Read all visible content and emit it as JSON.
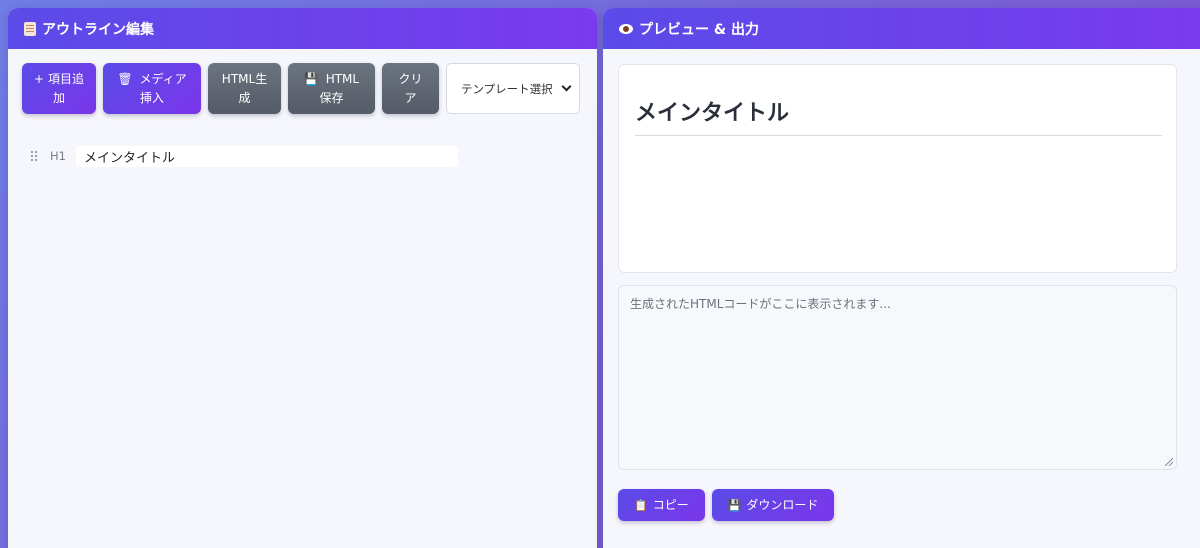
{
  "left_panel": {
    "title": "アウトライン編集",
    "toolbar": {
      "add_item": {
        "icon": "+",
        "line1": "項目追",
        "line2": "加"
      },
      "media_insert": {
        "icon": "🗑",
        "line1": "メディア",
        "line2": "挿入"
      },
      "html_generate": {
        "line1": "HTML生",
        "line2": "成"
      },
      "html_save": {
        "icon": "💾",
        "line1": "HTML",
        "line2": "保存"
      },
      "clear": {
        "line1": "クリ",
        "line2": "ア"
      },
      "template_select": {
        "label": "テンプレート選択"
      }
    },
    "outline_items": [
      {
        "level": "H1",
        "value": "メインタイトル"
      }
    ]
  },
  "right_panel": {
    "title": "プレビュー & 出力",
    "preview": {
      "heading": "メインタイトル"
    },
    "code_output": {
      "placeholder": "生成されたHTMLコードがここに表示されます..."
    },
    "copy_button": {
      "icon": "📋",
      "label": "コピー"
    },
    "download_button": {
      "icon": "💾",
      "label": "ダウンロード"
    }
  },
  "colors": {
    "accent_start": "#5a4be8",
    "accent_end": "#7b36ea",
    "gray_button": "#5f6670",
    "panel_bg": "#f6f7fc"
  }
}
